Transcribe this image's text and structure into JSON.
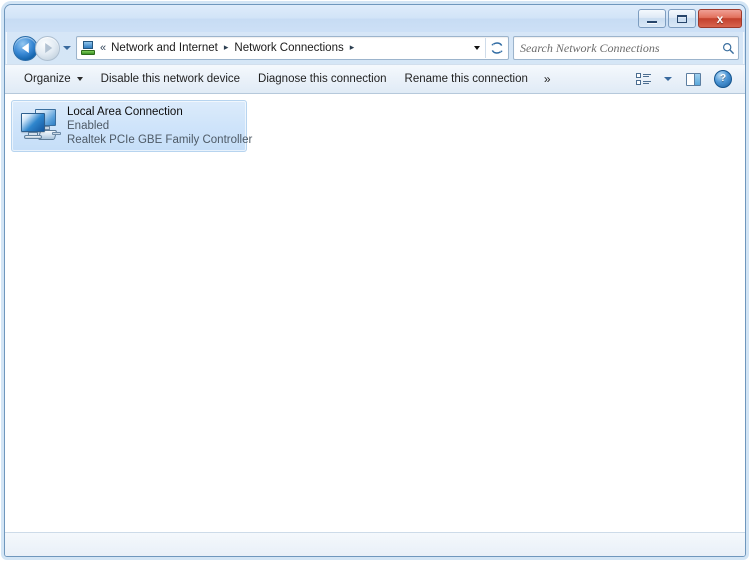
{
  "window": {
    "title": "",
    "caption_buttons": {
      "minimize": "Minimize",
      "maximize": "Maximize",
      "close": "x"
    }
  },
  "navigation": {
    "back_label": "Back",
    "forward_label": "Forward",
    "history_label": "Recent pages",
    "breadcrumb": {
      "overflow": "«",
      "items": [
        {
          "label": "Network and Internet",
          "separator": "▸"
        },
        {
          "label": "Network Connections",
          "separator": "▸"
        }
      ]
    },
    "address_dropdown_label": "Previous locations",
    "refresh_label": "Refresh"
  },
  "search": {
    "placeholder": "Search Network Connections",
    "value": "",
    "icon": "search-icon"
  },
  "toolbar": {
    "organize_label": "Organize",
    "items": [
      "Disable this network device",
      "Diagnose this connection",
      "Rename this connection"
    ],
    "overflow_label": "»",
    "change_view_label": "Change your view",
    "preview_pane_label": "Show the preview pane",
    "help_label": "?"
  },
  "content": {
    "connections": [
      {
        "name": "Local Area Connection",
        "status": "Enabled",
        "device": "Realtek PCIe GBE Family Controller",
        "icon": "network-connection-icon",
        "selected": true
      }
    ]
  },
  "statusbar": {
    "text": ""
  },
  "colors": {
    "frame": "#6f97bd",
    "titlebar_top": "#dfecfb",
    "close_button": "#c3402c",
    "selection": "#cfe4fa",
    "accent_blue": "#1464ad",
    "content_bg": "#ffffff"
  }
}
